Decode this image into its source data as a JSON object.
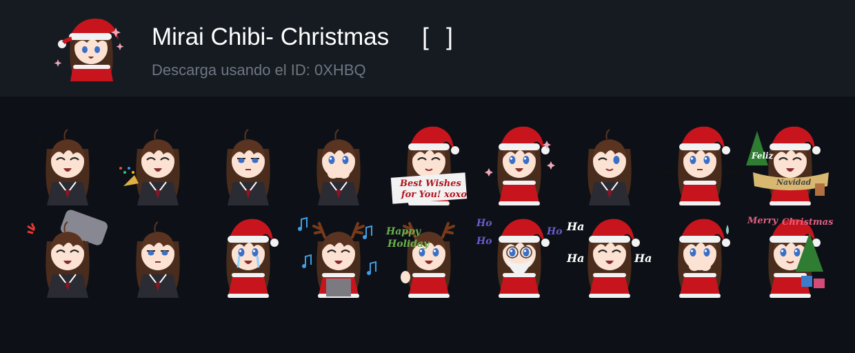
{
  "pack": {
    "title": "Mirai Chibi- Christmas",
    "bracket_open": "[",
    "bracket_close": "]",
    "id_text": "Descarga usando el ID: 0XHBQ",
    "icon": "mirai-santa-sticker"
  },
  "colors": {
    "background": "#0d1117",
    "header": "#161b22",
    "title": "#ffffff",
    "subtitle": "#6e7681"
  },
  "stickers": [
    {
      "name": "laughing-hand-mouth",
      "hat": "none",
      "outfit": "uniform",
      "eyes": "closed",
      "mouth": "grin",
      "extra": "marks",
      "texts": []
    },
    {
      "name": "party-popper",
      "hat": "none",
      "outfit": "uniform",
      "eyes": "closed",
      "mouth": "open",
      "extra": "popper",
      "texts": []
    },
    {
      "name": "neutral-stare",
      "hat": "none",
      "outfit": "uniform",
      "eyes": "half",
      "mouth": "flat",
      "extra": "",
      "texts": []
    },
    {
      "name": "hands-covering-mouth",
      "hat": "none",
      "outfit": "uniform",
      "eyes": "open",
      "mouth": "hands",
      "extra": "",
      "texts": []
    },
    {
      "name": "best-wishes-sign",
      "hat": "santa",
      "outfit": "santa",
      "eyes": "closed",
      "mouth": "smile",
      "extra": "sign",
      "texts": [
        "Best Wishes",
        "for You! xoxo"
      ]
    },
    {
      "name": "sparkles-happy",
      "hat": "santa",
      "outfit": "santa",
      "eyes": "open",
      "mouth": "open",
      "extra": "sparkles",
      "texts": []
    },
    {
      "name": "wink-salute",
      "hat": "none",
      "outfit": "uniform",
      "eyes": "wink",
      "mouth": "smile",
      "extra": "",
      "texts": []
    },
    {
      "name": "ellipsis-stare",
      "hat": "santa",
      "outfit": "santa",
      "eyes": "open",
      "mouth": "flat",
      "extra": "dots",
      "texts": []
    },
    {
      "name": "feliz-navidad-banner",
      "hat": "santa",
      "outfit": "santa",
      "eyes": "closed",
      "mouth": "open",
      "extra": "tree-banner",
      "texts": [
        "Feliz",
        "Navidad"
      ]
    },
    {
      "name": "angry-hammer",
      "hat": "none",
      "outfit": "uniform",
      "eyes": "closed",
      "mouth": "grin",
      "extra": "hammer",
      "texts": []
    },
    {
      "name": "hands-together-pout",
      "hat": "none",
      "outfit": "uniform",
      "eyes": "half",
      "mouth": "flat",
      "extra": "",
      "texts": []
    },
    {
      "name": "crying-santa",
      "hat": "santa",
      "outfit": "santa",
      "eyes": "cry",
      "mouth": "open",
      "extra": "",
      "texts": []
    },
    {
      "name": "reindeer-singing",
      "hat": "antlers",
      "outfit": "santa",
      "eyes": "closed",
      "mouth": "open",
      "extra": "notes",
      "texts": []
    },
    {
      "name": "happy-holiday-antlers",
      "hat": "antlers",
      "outfit": "santa",
      "eyes": "open",
      "mouth": "open",
      "extra": "wave",
      "texts": [
        "Happy",
        "Holiday"
      ]
    },
    {
      "name": "ho-ho-ho-beard",
      "hat": "santa",
      "outfit": "santa",
      "eyes": "open",
      "mouth": "beard",
      "extra": "glasses",
      "texts": [
        "Ho",
        "Ho",
        "Ho"
      ]
    },
    {
      "name": "ha-ha-ha-laugh",
      "hat": "santa",
      "outfit": "santa",
      "eyes": "closed",
      "mouth": "grin",
      "extra": "",
      "texts": [
        "Ha",
        "Ha",
        "Ha"
      ]
    },
    {
      "name": "nervous-sweat",
      "hat": "santa",
      "outfit": "santa",
      "eyes": "open",
      "mouth": "hands",
      "extra": "sweat",
      "texts": []
    },
    {
      "name": "merry-christmas-tree",
      "hat": "santa",
      "outfit": "santa",
      "eyes": "open",
      "mouth": "smile",
      "extra": "tree-gifts",
      "texts": [
        "Merry",
        "Christmas"
      ]
    }
  ]
}
